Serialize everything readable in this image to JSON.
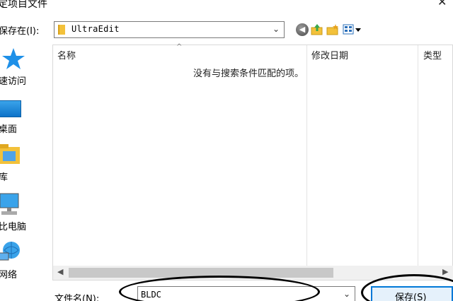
{
  "window": {
    "title": "定项目文件",
    "close_glyph": "✕"
  },
  "toolbar": {
    "save_in_label": "保存在(I):",
    "location": "UltraEdit"
  },
  "sidebar": {
    "items": [
      {
        "label": "速访问",
        "icon": "quick-access-star-icon"
      },
      {
        "label": "桌面",
        "icon": "desktop-icon"
      },
      {
        "label": "库",
        "icon": "library-icon"
      },
      {
        "label": "比电脑",
        "icon": "computer-icon"
      },
      {
        "label": "网络",
        "icon": "network-icon"
      }
    ]
  },
  "file_list": {
    "columns": [
      "名称",
      "修改日期",
      "类型"
    ],
    "empty_message": "没有与搜索条件匹配的项。"
  },
  "bottom": {
    "filename_label": "文件名(N):",
    "filename_value": "BLDC",
    "save_button": "保存(S)"
  },
  "colors": {
    "accent": "#0078d7",
    "button_bg": "#e5f1fb"
  }
}
